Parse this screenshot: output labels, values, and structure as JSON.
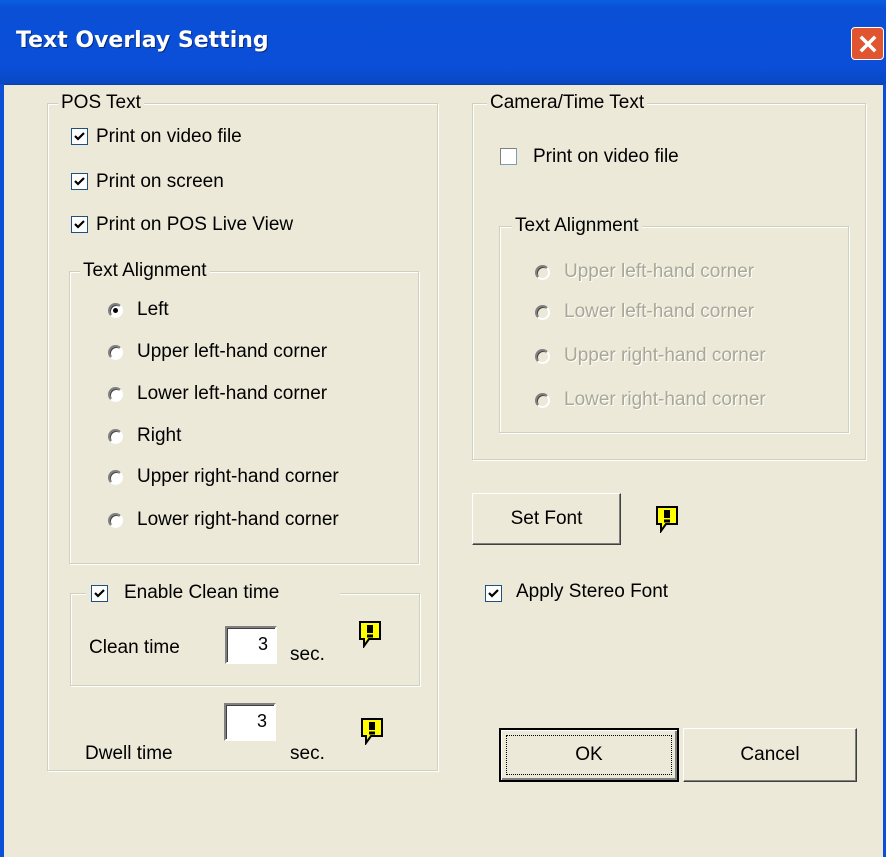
{
  "window": {
    "title": "Text Overlay Setting"
  },
  "pos_text": {
    "legend": "POS Text",
    "print_video": {
      "label": "Print on video file",
      "checked": true
    },
    "print_screen": {
      "label": "Print on screen",
      "checked": true
    },
    "print_live": {
      "label": "Print on POS Live View",
      "checked": true
    },
    "alignment": {
      "legend": "Text Alignment",
      "options": [
        "Left",
        "Upper left-hand corner",
        "Lower left-hand corner",
        "Right",
        "Upper right-hand corner",
        "Lower right-hand corner"
      ],
      "selected": "Left"
    },
    "clean": {
      "label": "Enable Clean time",
      "checked": true,
      "time_label": "Clean time",
      "value": "3",
      "unit": "sec."
    },
    "dwell": {
      "label": "Dwell time",
      "value": "3",
      "unit": "sec."
    }
  },
  "camera_text": {
    "legend": "Camera/Time Text",
    "print_video": {
      "label": "Print on video file",
      "checked": false
    },
    "alignment": {
      "legend": "Text Alignment",
      "options": [
        "Upper left-hand corner",
        "Lower left-hand corner",
        "Upper right-hand corner",
        "Lower right-hand corner"
      ],
      "enabled": false
    }
  },
  "font": {
    "set_label": "Set Font",
    "stereo_label": "Apply Stereo Font",
    "stereo_checked": true
  },
  "buttons": {
    "ok": "OK",
    "cancel": "Cancel"
  },
  "icons": {
    "warning": "warning-info-icon",
    "close": "close-icon",
    "check": "checkmark-icon"
  },
  "colors": {
    "titlebar": "#0a4fd6",
    "dialog": "#ece9d8",
    "close": "#e0542f",
    "warning": "#ffff00"
  }
}
